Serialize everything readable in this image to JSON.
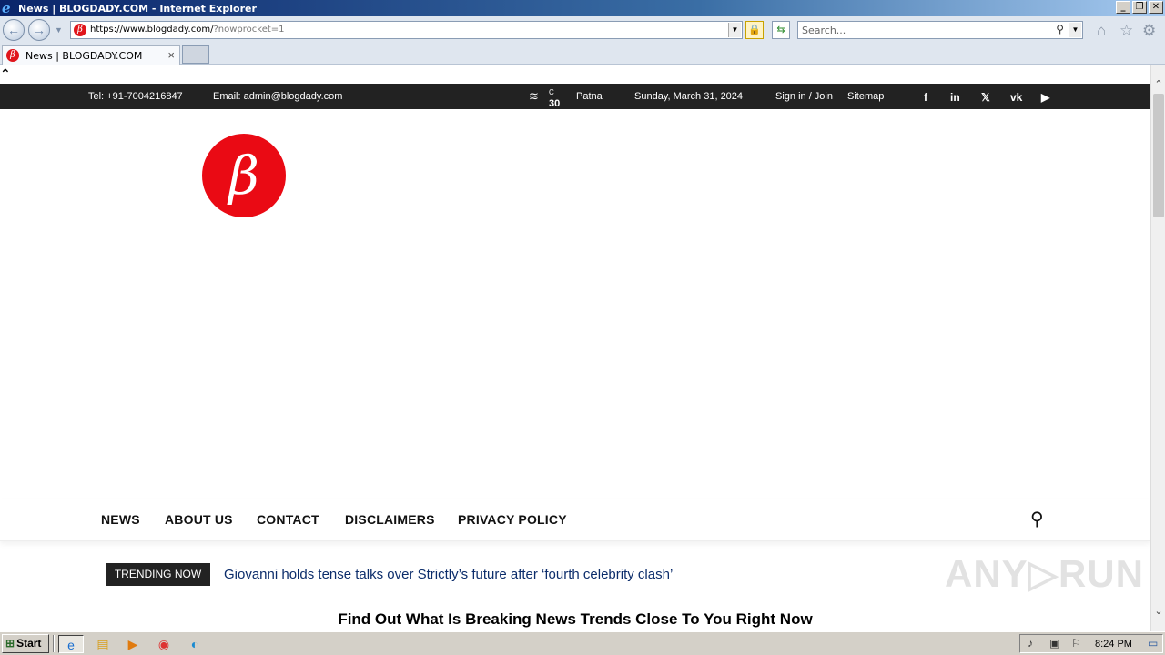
{
  "window": {
    "title": "News | BLOGDADY.COM - Internet Explorer",
    "controls": [
      "_",
      "❐",
      "✕"
    ]
  },
  "address_bar": {
    "url_main": "https://www.blogdady.com/",
    "url_query": "?nowprocket=1",
    "search_placeholder": "Search..."
  },
  "tabs": [
    {
      "label": "News | BLOGDADY.COM",
      "close": "×"
    }
  ],
  "page": {
    "back_to_top": "⌃",
    "topbar": {
      "phone": "Tel: +91-7004216847",
      "email": "Email: admin@blogdady.com",
      "temperature": "30",
      "temp_unit": "C",
      "city": "Patna",
      "date": "Sunday, March 31, 2024",
      "signin": "Sign in / Join",
      "sitemap": "Sitemap",
      "social": [
        "f",
        "in",
        "𝕏",
        "vk",
        "▶"
      ]
    },
    "logo_letter": "β",
    "nav": [
      "NEWS",
      "ABOUT US",
      "CONTACT",
      "DISCLAIMERS",
      "PRIVACY POLICY"
    ],
    "trending": {
      "tag": "TRENDING NOW",
      "text": "Giovanni holds tense talks over Strictly’s future after ‘fourth celebrity clash’"
    },
    "headline": "Find Out What Is Breaking News Trends Close To You Right Now",
    "watermark": "ANY▷RUN"
  },
  "taskbar": {
    "start": "Start",
    "clock": "8:24 PM"
  }
}
